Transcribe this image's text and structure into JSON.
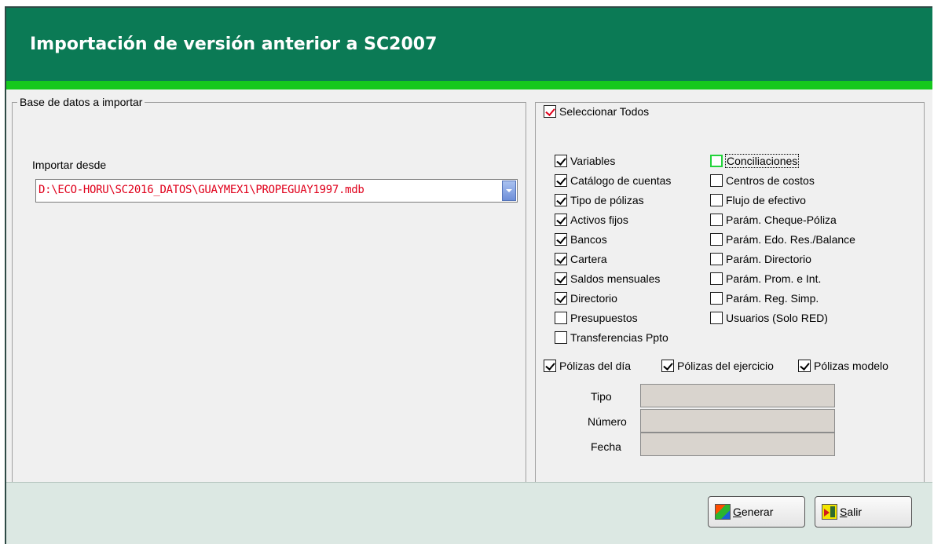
{
  "window": {
    "title": "Importación de versión anterior a SC2007"
  },
  "left_panel": {
    "group_label": "Base de datos a importar",
    "field_label": "Importar desde",
    "field_value": "D:\\ECO-HORU\\SC2016_DATOS\\GUAYMEX1\\PROPEGUAY1997.mdb"
  },
  "right_panel": {
    "select_all": {
      "label": "Seleccionar Todos",
      "checked": true
    },
    "col1": [
      {
        "label": "Variables",
        "checked": true
      },
      {
        "label": "Catálogo de cuentas",
        "checked": true
      },
      {
        "label": "Tipo de pólizas",
        "checked": true
      },
      {
        "label": "Activos fijos",
        "checked": true
      },
      {
        "label": "Bancos",
        "checked": true
      },
      {
        "label": "Cartera",
        "checked": true
      },
      {
        "label": "Saldos mensuales",
        "checked": true
      },
      {
        "label": "Directorio",
        "checked": true
      },
      {
        "label": "Presupuestos",
        "checked": false
      },
      {
        "label": "Transferencias Ppto",
        "checked": false
      }
    ],
    "col2": [
      {
        "label": "Conciliaciones",
        "checked": false
      },
      {
        "label": "Centros de costos",
        "checked": false
      },
      {
        "label": "Flujo de efectivo",
        "checked": false
      },
      {
        "label": "Parám. Cheque-Póliza",
        "checked": false
      },
      {
        "label": "Parám. Edo. Res./Balance",
        "checked": false
      },
      {
        "label": "Parám. Directorio",
        "checked": false
      },
      {
        "label": "Parám. Prom. e Int.",
        "checked": false
      },
      {
        "label": "Parám. Reg. Simp.",
        "checked": false
      },
      {
        "label": "Usuarios (Solo RED)",
        "checked": false
      }
    ],
    "polizas": [
      {
        "label": "Pólizas del día",
        "checked": true
      },
      {
        "label": "Pólizas del ejercicio",
        "checked": true
      },
      {
        "label": "Pólizas modelo",
        "checked": true
      }
    ],
    "fields": {
      "tipo_label": "Tipo",
      "numero_label": "Número",
      "fecha_label": "Fecha",
      "tipo_value": "",
      "numero_value": "",
      "fecha_value": ""
    }
  },
  "footer": {
    "generate_label_first": "G",
    "generate_label_rest": "enerar",
    "exit_label_first": "S",
    "exit_label_rest": "alir"
  },
  "colors": {
    "title_bar": "#0b7a55",
    "stripe": "#16c91d",
    "path_text": "#e0001b",
    "footer_bg": "#dce8e3"
  }
}
